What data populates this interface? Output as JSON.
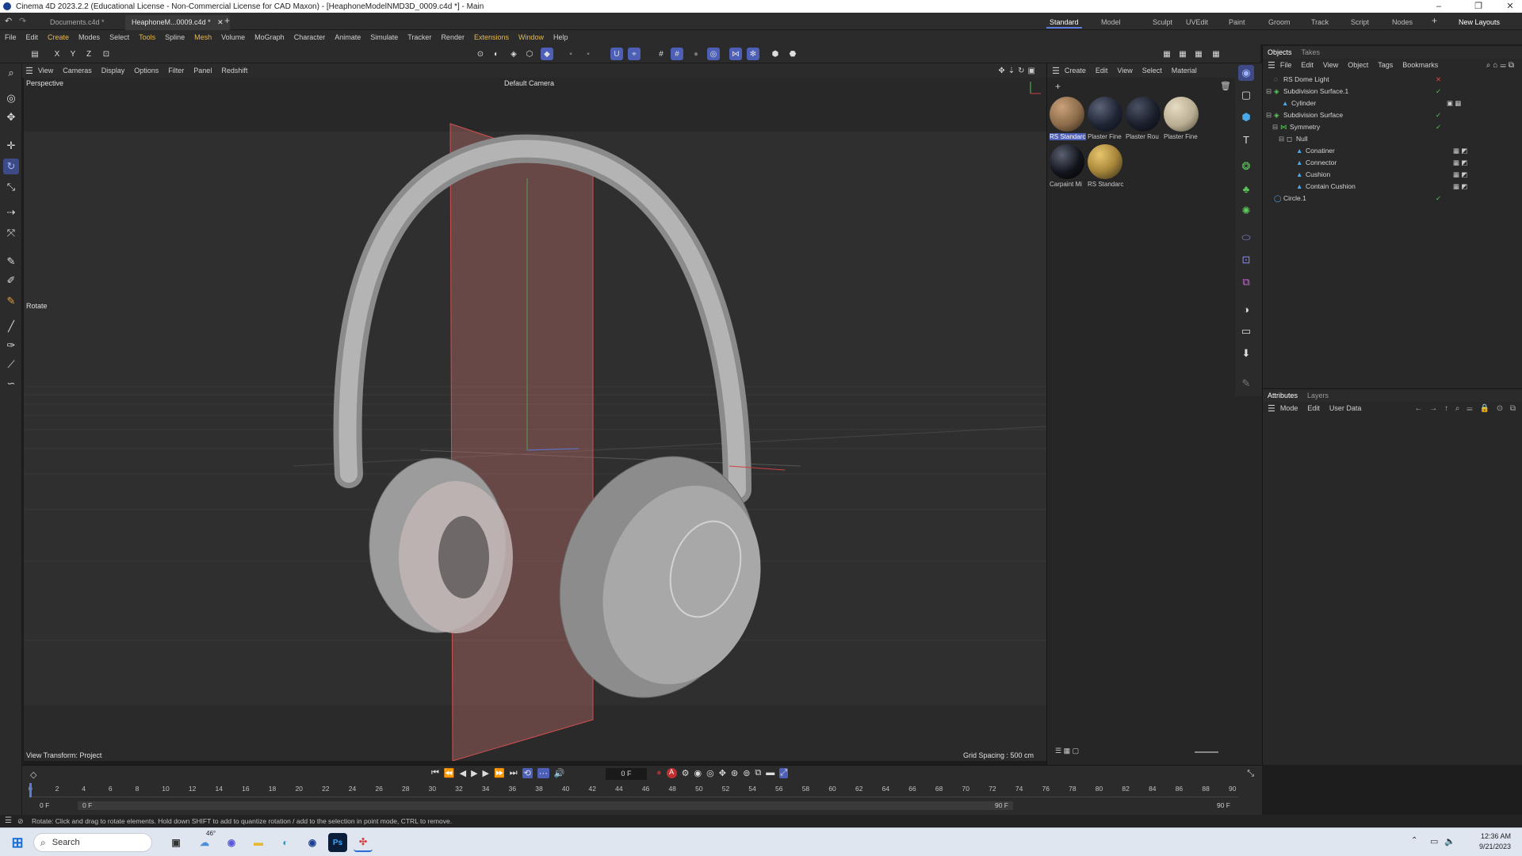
{
  "window": {
    "title": "Cinema 4D 2023.2.2 (Educational License - Non-Commercial License for CAD Maxon) - [HeaphoneModelNMD3D_0009.c4d *] - Main"
  },
  "doc_tabs": [
    {
      "label": "Documents.c4d *",
      "active": false
    },
    {
      "label": "HeaphoneM...0009.c4d *",
      "active": true
    }
  ],
  "layouts": [
    "Standard",
    "Model",
    "Sculpt",
    "UVEdit",
    "Paint",
    "Groom",
    "Track",
    "Script",
    "Nodes"
  ],
  "new_layouts_label": "New Layouts",
  "menus": [
    "File",
    "Edit",
    "Create",
    "Modes",
    "Select",
    "Tools",
    "Spline",
    "Mesh",
    "Volume",
    "MoGraph",
    "Character",
    "Animate",
    "Simulate",
    "Tracker",
    "Render",
    "Extensions",
    "Window",
    "Help"
  ],
  "axes": [
    "X",
    "Y",
    "Z"
  ],
  "viewport": {
    "menus": [
      "View",
      "Cameras",
      "Display",
      "Options",
      "Filter",
      "Panel",
      "Redshift"
    ],
    "view_name": "Perspective",
    "camera": "Default Camera",
    "tool_hud": "Rotate",
    "view_transform": "View Transform: Project",
    "grid_spacing": "Grid Spacing : 500 cm"
  },
  "material_manager": {
    "menus": [
      "Create",
      "Edit",
      "View",
      "Select",
      "Material"
    ],
    "materials": [
      {
        "label": "RS Standarc",
        "color": "#8a6a48"
      },
      {
        "label": "Plaster Fine",
        "color": "#1e2433"
      },
      {
        "label": "Plaster Rou",
        "color": "#1a1e2a"
      },
      {
        "label": "Plaster Fine",
        "color": "#b9ad92"
      },
      {
        "label": "Carpaint Mi",
        "color": "#12141c"
      },
      {
        "label": "RS Standarc",
        "color": "#a8873a"
      }
    ]
  },
  "object_manager": {
    "tabs": [
      "Objects",
      "Takes"
    ],
    "menus": [
      "File",
      "Edit",
      "View",
      "Object",
      "Tags",
      "Bookmarks"
    ],
    "objects": [
      {
        "name": "RS Dome Light",
        "status": "x"
      },
      {
        "name": "Subdivision Surface.1",
        "status": "check"
      },
      {
        "name": "Cylinder",
        "status": ""
      },
      {
        "name": "Subdivision Surface",
        "status": "check"
      },
      {
        "name": "Symmetry",
        "status": "check"
      },
      {
        "name": "Null",
        "status": ""
      },
      {
        "name": "Conatiner",
        "status": ""
      },
      {
        "name": "Connector",
        "status": ""
      },
      {
        "name": "Cushion",
        "status": ""
      },
      {
        "name": "Contain Cushion",
        "status": ""
      },
      {
        "name": "Circle.1",
        "status": "check"
      }
    ]
  },
  "attributes": {
    "tabs": [
      "Attributes",
      "Layers"
    ],
    "menus": [
      "Mode",
      "Edit",
      "User Data"
    ]
  },
  "timeline": {
    "ticks": [
      "0",
      "2",
      "4",
      "6",
      "8",
      "10",
      "12",
      "14",
      "16",
      "18",
      "20",
      "22",
      "24",
      "26",
      "28",
      "30",
      "32",
      "34",
      "36",
      "38",
      "40",
      "42",
      "44",
      "46",
      "48",
      "50",
      "52",
      "54",
      "56",
      "58",
      "60",
      "62",
      "64",
      "66",
      "68",
      "70",
      "72",
      "74",
      "76",
      "78",
      "80",
      "82",
      "84",
      "86",
      "88",
      "90"
    ],
    "current_frame": "0 F",
    "start_a": "0 F",
    "start_b": "0 F",
    "end_a": "90 F",
    "end_b": "90 F"
  },
  "status_text": "Rotate: Click and drag to rotate elements. Hold down SHIFT to add to quantize rotation / add to the selection in point mode, CTRL to remove.",
  "taskbar": {
    "search_placeholder": "Search",
    "weather": "46°",
    "time": "12:36 AM",
    "date": "9/21/2023"
  },
  "colors": {
    "accent": "#4e5fb8",
    "axis_x": "#d04040",
    "axis_y": "#50c050"
  }
}
